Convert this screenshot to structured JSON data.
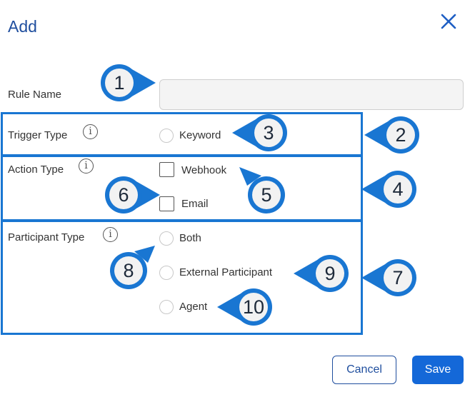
{
  "dialog": {
    "title": "Add",
    "close_icon": "close-icon"
  },
  "fields": {
    "rule_name": {
      "label": "Rule Name",
      "value": "",
      "placeholder": ""
    },
    "trigger_type": {
      "label": "Trigger Type",
      "info_icon": "info-icon",
      "options": [
        "Keyword"
      ]
    },
    "action_type": {
      "label": "Action Type",
      "info_icon": "info-icon",
      "options": [
        "Webhook",
        "Email"
      ]
    },
    "participant_type": {
      "label": "Participant Type",
      "info_icon": "info-icon",
      "options": [
        "Both",
        "External Participant",
        "Agent"
      ]
    }
  },
  "buttons": {
    "cancel": "Cancel",
    "save": "Save"
  },
  "callouts": [
    "1",
    "2",
    "3",
    "4",
    "5",
    "6",
    "7",
    "8",
    "9",
    "10"
  ],
  "colors": {
    "title": "#1f4e9e",
    "highlight_border": "#1976d2",
    "callout_fill": "#1976d2",
    "save_button": "#1468d8"
  }
}
